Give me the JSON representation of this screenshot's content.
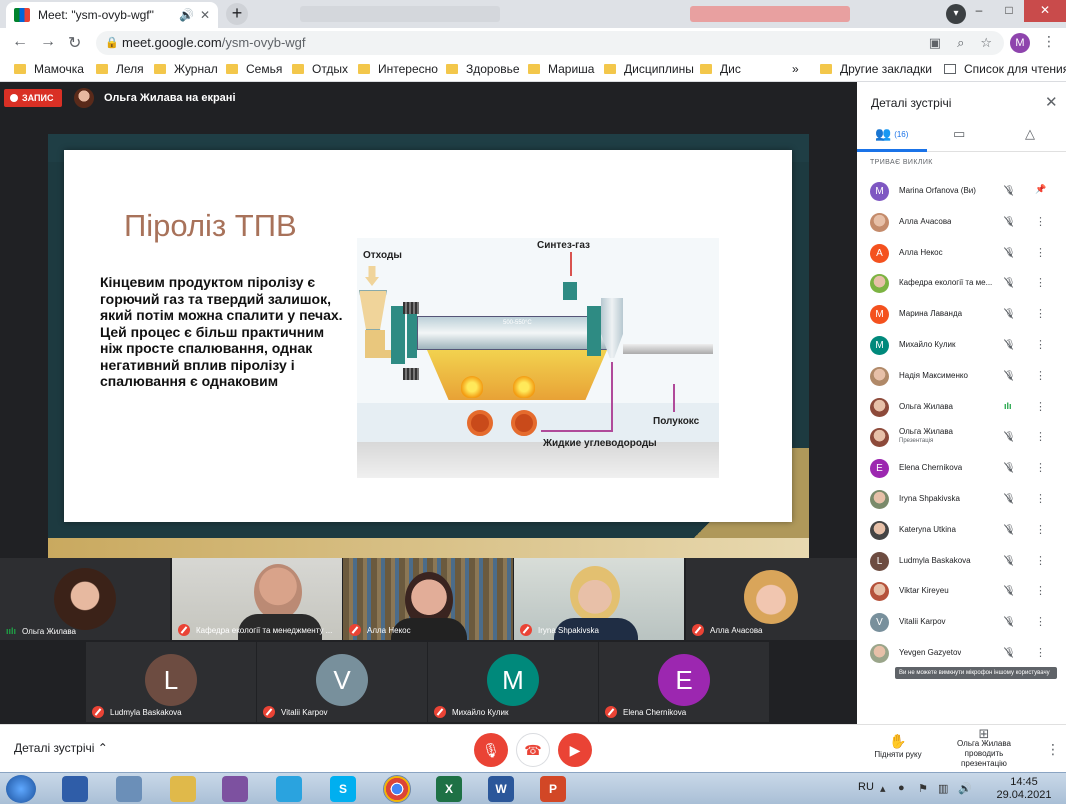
{
  "browser": {
    "tab_title": "Meet: \"ysm-ovyb-wgf\"",
    "tab_audio_icon": "speaker-icon",
    "tab_close": "✕",
    "new_tab": "+",
    "url_host": "meet.google.com",
    "url_path": "/ysm-ovyb-wgf",
    "profile_initial": "M"
  },
  "bookmarks": {
    "items": [
      "Мамочка",
      "Леля",
      "Журнал",
      "Семья",
      "Отдых",
      "Интересно",
      "Здоровье",
      "Мариша",
      "Дисциплины",
      "Дис"
    ],
    "overflow": "»",
    "other": "Другие закладки",
    "reading_list": "Список для чтения"
  },
  "meet": {
    "recording": "ЗАПИС",
    "presenter_label": "Ольга Жилава на екрані"
  },
  "slide": {
    "title": "Піроліз ТПВ",
    "body": "Кінцевим продуктом піролізу є горючий газ та твердий залишок, який потім можна спалити у печах. Цей процес є більш практичним ніж просте спалювання, однак негативний вплив піролізу і спалювання є однаковим",
    "diagram": {
      "waste": "Отходы",
      "syngas": "Синтез-газ",
      "temperature": "500-550°C",
      "semicoke": "Полукокс",
      "hydrocarbons": "Жидкие углеводороды"
    }
  },
  "tiles": {
    "row1": [
      {
        "name": "Ольга Жилава",
        "mic": "on"
      },
      {
        "name": "Кафедра екології та менеджменту ...",
        "mic": "off"
      },
      {
        "name": "Алла Некос",
        "mic": "off"
      },
      {
        "name": "Iryna Shpakivska",
        "mic": "off"
      },
      {
        "name": "Алла Ачасова",
        "mic": "off"
      }
    ],
    "row2": [
      {
        "name": "Ludmyla Baskakova",
        "initial": "L",
        "color": "#6d4c41"
      },
      {
        "name": "Vitalii Karpov",
        "initial": "V",
        "color": "#78909c"
      },
      {
        "name": "Михайло Кулик",
        "initial": "M",
        "color": "#00897b"
      },
      {
        "name": "Elena Chernikova",
        "initial": "E",
        "color": "#9c27b0"
      }
    ]
  },
  "bottom": {
    "details": "Деталі зустрічі",
    "raise_hand": "Підняти руку",
    "presenting_line1": "Ольга Жилава",
    "presenting_line2": "проводить презентацію"
  },
  "panel": {
    "title": "Деталі зустрічі",
    "people_count": "(16)",
    "section": "ТРИВАЄ ВИКЛИК",
    "participants": [
      {
        "name": "Marina Orfanova (Ви)",
        "initial": "M",
        "color": "#7e57c2",
        "mic": "muted",
        "extra": "pin"
      },
      {
        "name": "Алла Ачасова",
        "photo": true,
        "color": "#c48b6b",
        "mic": "muted"
      },
      {
        "name": "Алла Некос",
        "initial": "А",
        "color": "#f4511e",
        "mic": "muted"
      },
      {
        "name": "Кафедра екології та ме...",
        "photo": true,
        "color": "#7cb342",
        "mic": "muted"
      },
      {
        "name": "Марина Лаванда",
        "initial": "М",
        "color": "#f4511e",
        "mic": "muted"
      },
      {
        "name": "Михайло Кулик",
        "initial": "М",
        "color": "#00897b",
        "mic": "muted"
      },
      {
        "name": "Надія Максименко",
        "photo": true,
        "color": "#b08968",
        "mic": "muted"
      },
      {
        "name": "Ольга Жилава",
        "photo": true,
        "color": "#8d4a3a",
        "mic": "speaking"
      },
      {
        "name": "Ольга Жилава",
        "sub": "Презентація",
        "photo": true,
        "color": "#8d4a3a",
        "mic": "muted"
      },
      {
        "name": "Elena Chernikova",
        "initial": "E",
        "color": "#9c27b0",
        "mic": "muted"
      },
      {
        "name": "Iryna Shpakivska",
        "photo": true,
        "color": "#7a8a6a",
        "mic": "muted"
      },
      {
        "name": "Kateryna Utkina",
        "photo": true,
        "color": "#444444",
        "mic": "muted"
      },
      {
        "name": "Ludmyla Baskakova",
        "initial": "L",
        "color": "#6d4c41",
        "mic": "muted"
      },
      {
        "name": "Viktar Kireyeu",
        "photo": true,
        "color": "#b5523b",
        "mic": "muted"
      },
      {
        "name": "Vitalii Karpov",
        "initial": "V",
        "color": "#78909c",
        "mic": "muted"
      },
      {
        "name": "Yevgen Gazyetov",
        "photo": true,
        "color": "#9aa58a",
        "mic": "muted"
      }
    ],
    "tooltip": "Ви не можете вимкнути мікрофон іншому користувачу"
  },
  "taskbar": {
    "lang": "RU",
    "time": "14:45",
    "date": "29.04.2021",
    "apps": [
      {
        "name": "media-player-icon",
        "label": "",
        "color": "#2f5da8"
      },
      {
        "name": "calculator-icon",
        "label": "",
        "color": "#6b8fb8"
      },
      {
        "name": "explorer-icon",
        "label": "",
        "color": "#e0b94a"
      },
      {
        "name": "viber-icon",
        "label": "",
        "color": "#7d51a0"
      },
      {
        "name": "telegram-icon",
        "label": "",
        "color": "#2aa3df"
      },
      {
        "name": "skype-icon",
        "label": "S",
        "color": "#00aff0"
      },
      {
        "name": "chrome-icon",
        "label": "",
        "color": "#db4437"
      },
      {
        "name": "excel-icon",
        "label": "X",
        "color": "#1e7145"
      },
      {
        "name": "word-icon",
        "label": "W",
        "color": "#2b579a"
      },
      {
        "name": "powerpoint-icon",
        "label": "P",
        "color": "#d24726"
      }
    ]
  },
  "colors": {
    "meet_red": "#ea4335",
    "accent_blue": "#1a73e8",
    "slide_title": "#a8725a"
  }
}
